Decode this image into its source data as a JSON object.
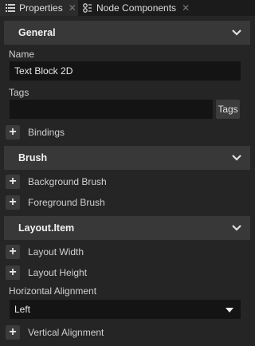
{
  "tabs": [
    {
      "label": "Properties",
      "icon": "list-icon"
    },
    {
      "label": "Node Components",
      "icon": "node-components-icon"
    }
  ],
  "sections": {
    "general": "General",
    "brush": "Brush",
    "layout_item": "Layout.Item"
  },
  "fields": {
    "name_label": "Name",
    "name_value": "Text Block 2D",
    "tags_label": "Tags",
    "tags_value": "",
    "tags_button": "Tags",
    "horizontal_alignment_label": "Horizontal Alignment",
    "horizontal_alignment_value": "Left"
  },
  "properties": {
    "bindings": "Bindings",
    "background_brush": "Background Brush",
    "foreground_brush": "Foreground Brush",
    "layout_width": "Layout Width",
    "layout_height": "Layout Height",
    "vertical_alignment": "Vertical Alignment"
  },
  "colors": {
    "panel_bg": "#252525",
    "section_bg": "#383838",
    "field_bg": "#141414",
    "tab_bar_bg": "#1b1b1b"
  }
}
